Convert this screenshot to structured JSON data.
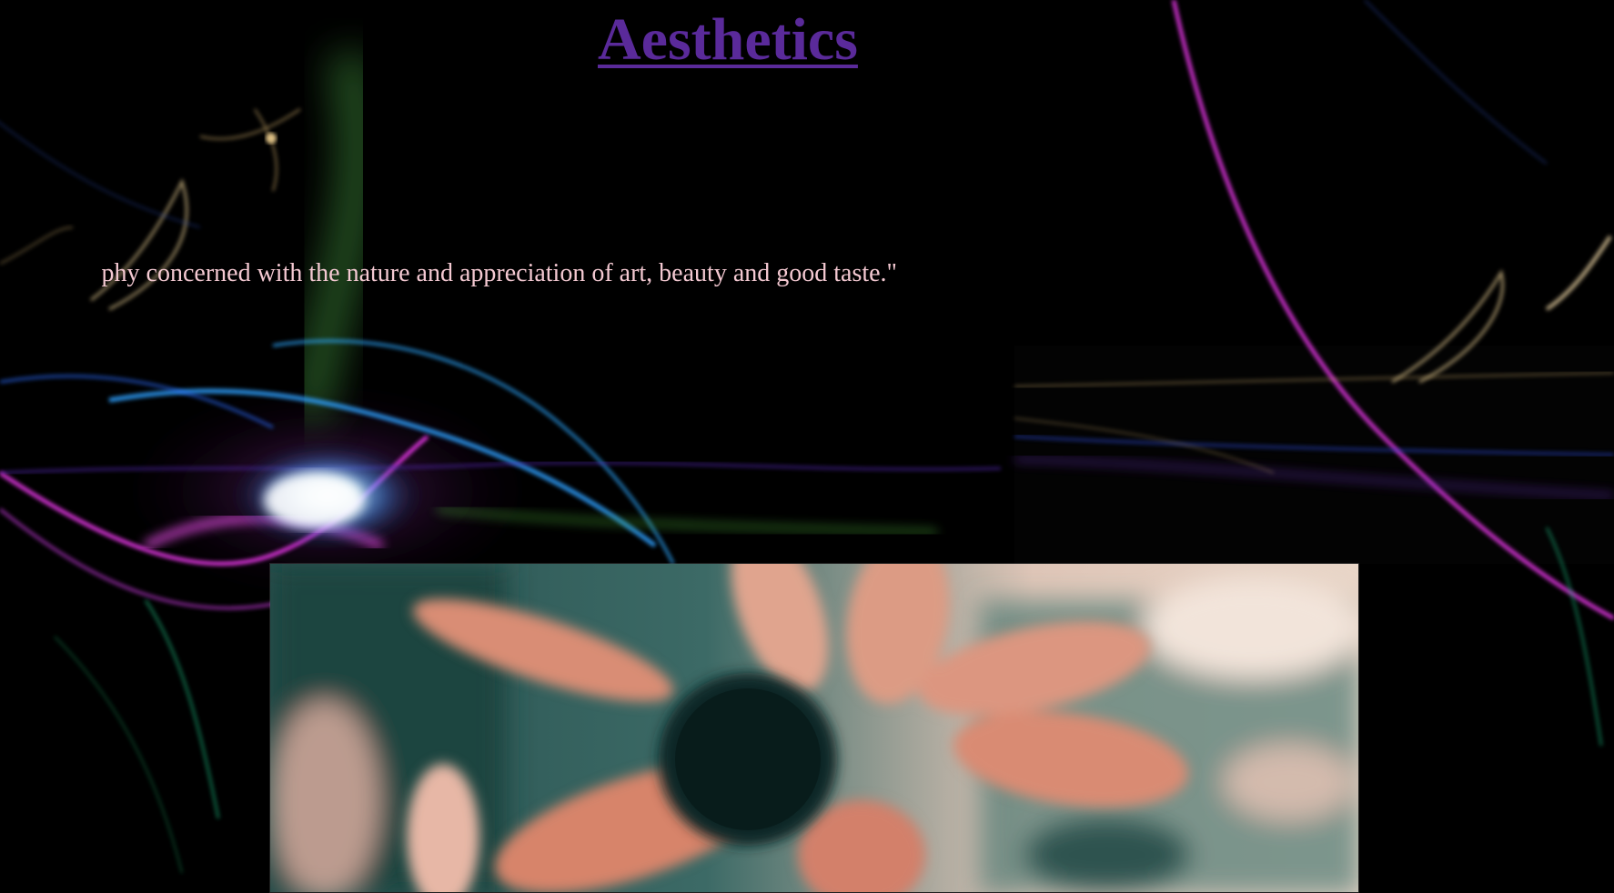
{
  "page": {
    "title": "Aesthetics",
    "quote_visible": "phy concerned with the nature and appreciation of art, beauty and good taste.\""
  },
  "colors": {
    "background": "#000000",
    "title": "#5a2a9a",
    "quote_text": "#f4c9d2"
  },
  "images": {
    "background": "cosmic-swirl-background",
    "photo": "blurred-pink-flower-photo"
  }
}
